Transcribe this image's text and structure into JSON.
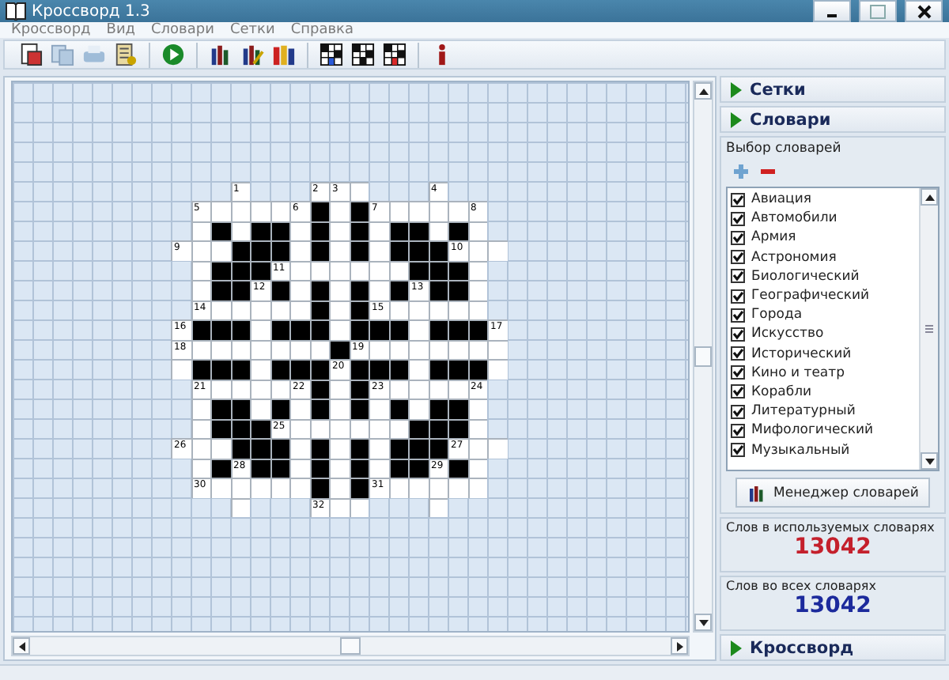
{
  "window": {
    "title": "Кроссворд 1.3"
  },
  "menu": [
    "Кроссворд",
    "Вид",
    "Словари",
    "Сетки",
    "Справка"
  ],
  "crossword": {
    "rows": [
      {
        "cells": [
          {
            "kind": "empty"
          },
          {
            "kind": "empty"
          },
          {
            "kind": "empty"
          },
          {
            "kind": "white",
            "number": "1"
          },
          {
            "kind": "empty"
          },
          {
            "kind": "empty"
          },
          {
            "kind": "empty"
          },
          {
            "kind": "white",
            "number": "2"
          },
          {
            "kind": "white",
            "number": "3"
          },
          {
            "kind": "white"
          },
          {
            "kind": "empty"
          },
          {
            "kind": "empty"
          },
          {
            "kind": "empty"
          },
          {
            "kind": "white",
            "number": "4"
          },
          {
            "kind": "empty"
          },
          {
            "kind": "empty"
          },
          {
            "kind": "empty"
          }
        ]
      },
      {
        "cells": [
          {
            "kind": "empty"
          },
          {
            "kind": "white",
            "number": "5"
          },
          {
            "kind": "white"
          },
          {
            "kind": "white"
          },
          {
            "kind": "white"
          },
          {
            "kind": "white"
          },
          {
            "kind": "white",
            "number": "6"
          },
          {
            "kind": "black"
          },
          {
            "kind": "white"
          },
          {
            "kind": "black"
          },
          {
            "kind": "white",
            "number": "7"
          },
          {
            "kind": "white"
          },
          {
            "kind": "white"
          },
          {
            "kind": "white"
          },
          {
            "kind": "white"
          },
          {
            "kind": "white",
            "number": "8"
          },
          {
            "kind": "empty"
          }
        ]
      },
      {
        "cells": [
          {
            "kind": "empty"
          },
          {
            "kind": "white"
          },
          {
            "kind": "black"
          },
          {
            "kind": "white"
          },
          {
            "kind": "black"
          },
          {
            "kind": "black"
          },
          {
            "kind": "white"
          },
          {
            "kind": "black"
          },
          {
            "kind": "white"
          },
          {
            "kind": "black"
          },
          {
            "kind": "white"
          },
          {
            "kind": "black"
          },
          {
            "kind": "black"
          },
          {
            "kind": "white"
          },
          {
            "kind": "black"
          },
          {
            "kind": "white"
          },
          {
            "kind": "empty"
          }
        ]
      },
      {
        "cells": [
          {
            "kind": "white",
            "number": "9"
          },
          {
            "kind": "white"
          },
          {
            "kind": "white"
          },
          {
            "kind": "black"
          },
          {
            "kind": "black"
          },
          {
            "kind": "black"
          },
          {
            "kind": "white"
          },
          {
            "kind": "black"
          },
          {
            "kind": "white"
          },
          {
            "kind": "black"
          },
          {
            "kind": "white"
          },
          {
            "kind": "black"
          },
          {
            "kind": "black"
          },
          {
            "kind": "black"
          },
          {
            "kind": "white",
            "number": "10"
          },
          {
            "kind": "white"
          },
          {
            "kind": "white"
          }
        ]
      },
      {
        "cells": [
          {
            "kind": "empty"
          },
          {
            "kind": "white"
          },
          {
            "kind": "black"
          },
          {
            "kind": "black"
          },
          {
            "kind": "black"
          },
          {
            "kind": "white",
            "number": "11"
          },
          {
            "kind": "white"
          },
          {
            "kind": "white"
          },
          {
            "kind": "white"
          },
          {
            "kind": "white"
          },
          {
            "kind": "white"
          },
          {
            "kind": "white"
          },
          {
            "kind": "black"
          },
          {
            "kind": "black"
          },
          {
            "kind": "black"
          },
          {
            "kind": "white"
          },
          {
            "kind": "empty"
          }
        ]
      },
      {
        "cells": [
          {
            "kind": "empty"
          },
          {
            "kind": "white"
          },
          {
            "kind": "black"
          },
          {
            "kind": "black"
          },
          {
            "kind": "white",
            "number": "12"
          },
          {
            "kind": "black"
          },
          {
            "kind": "white"
          },
          {
            "kind": "black"
          },
          {
            "kind": "white"
          },
          {
            "kind": "black"
          },
          {
            "kind": "white"
          },
          {
            "kind": "black"
          },
          {
            "kind": "white",
            "number": "13"
          },
          {
            "kind": "black"
          },
          {
            "kind": "black"
          },
          {
            "kind": "white"
          },
          {
            "kind": "empty"
          }
        ]
      },
      {
        "cells": [
          {
            "kind": "empty"
          },
          {
            "kind": "white",
            "number": "14"
          },
          {
            "kind": "white"
          },
          {
            "kind": "white"
          },
          {
            "kind": "white"
          },
          {
            "kind": "white"
          },
          {
            "kind": "white"
          },
          {
            "kind": "black"
          },
          {
            "kind": "white"
          },
          {
            "kind": "black"
          },
          {
            "kind": "white",
            "number": "15"
          },
          {
            "kind": "white"
          },
          {
            "kind": "white"
          },
          {
            "kind": "white"
          },
          {
            "kind": "white"
          },
          {
            "kind": "white"
          },
          {
            "kind": "empty"
          }
        ]
      },
      {
        "cells": [
          {
            "kind": "white",
            "number": "16"
          },
          {
            "kind": "black"
          },
          {
            "kind": "black"
          },
          {
            "kind": "black"
          },
          {
            "kind": "white"
          },
          {
            "kind": "black"
          },
          {
            "kind": "black"
          },
          {
            "kind": "black"
          },
          {
            "kind": "white"
          },
          {
            "kind": "black"
          },
          {
            "kind": "black"
          },
          {
            "kind": "black"
          },
          {
            "kind": "white"
          },
          {
            "kind": "black"
          },
          {
            "kind": "black"
          },
          {
            "kind": "black"
          },
          {
            "kind": "white",
            "number": "17"
          }
        ]
      },
      {
        "cells": [
          {
            "kind": "white",
            "number": "18"
          },
          {
            "kind": "white"
          },
          {
            "kind": "white"
          },
          {
            "kind": "white"
          },
          {
            "kind": "white"
          },
          {
            "kind": "white"
          },
          {
            "kind": "white"
          },
          {
            "kind": "white"
          },
          {
            "kind": "black"
          },
          {
            "kind": "white",
            "number": "19"
          },
          {
            "kind": "white"
          },
          {
            "kind": "white"
          },
          {
            "kind": "white"
          },
          {
            "kind": "white"
          },
          {
            "kind": "white"
          },
          {
            "kind": "white"
          },
          {
            "kind": "white"
          }
        ]
      },
      {
        "cells": [
          {
            "kind": "white"
          },
          {
            "kind": "black"
          },
          {
            "kind": "black"
          },
          {
            "kind": "black"
          },
          {
            "kind": "white"
          },
          {
            "kind": "black"
          },
          {
            "kind": "black"
          },
          {
            "kind": "black"
          },
          {
            "kind": "white",
            "number": "20"
          },
          {
            "kind": "black"
          },
          {
            "kind": "black"
          },
          {
            "kind": "black"
          },
          {
            "kind": "white"
          },
          {
            "kind": "black"
          },
          {
            "kind": "black"
          },
          {
            "kind": "black"
          },
          {
            "kind": "white"
          }
        ]
      },
      {
        "cells": [
          {
            "kind": "empty"
          },
          {
            "kind": "white",
            "number": "21"
          },
          {
            "kind": "white"
          },
          {
            "kind": "white"
          },
          {
            "kind": "white"
          },
          {
            "kind": "white"
          },
          {
            "kind": "white",
            "number": "22"
          },
          {
            "kind": "black"
          },
          {
            "kind": "white"
          },
          {
            "kind": "black"
          },
          {
            "kind": "white",
            "number": "23"
          },
          {
            "kind": "white"
          },
          {
            "kind": "white"
          },
          {
            "kind": "white"
          },
          {
            "kind": "white"
          },
          {
            "kind": "white",
            "number": "24"
          },
          {
            "kind": "empty"
          }
        ]
      },
      {
        "cells": [
          {
            "kind": "empty"
          },
          {
            "kind": "white"
          },
          {
            "kind": "black"
          },
          {
            "kind": "black"
          },
          {
            "kind": "white"
          },
          {
            "kind": "black"
          },
          {
            "kind": "white"
          },
          {
            "kind": "black"
          },
          {
            "kind": "white"
          },
          {
            "kind": "black"
          },
          {
            "kind": "white"
          },
          {
            "kind": "black"
          },
          {
            "kind": "white"
          },
          {
            "kind": "black"
          },
          {
            "kind": "black"
          },
          {
            "kind": "white"
          },
          {
            "kind": "empty"
          }
        ]
      },
      {
        "cells": [
          {
            "kind": "empty"
          },
          {
            "kind": "white"
          },
          {
            "kind": "black"
          },
          {
            "kind": "black"
          },
          {
            "kind": "black"
          },
          {
            "kind": "white",
            "number": "25"
          },
          {
            "kind": "white"
          },
          {
            "kind": "white"
          },
          {
            "kind": "white"
          },
          {
            "kind": "white"
          },
          {
            "kind": "white"
          },
          {
            "kind": "white"
          },
          {
            "kind": "black"
          },
          {
            "kind": "black"
          },
          {
            "kind": "black"
          },
          {
            "kind": "white"
          },
          {
            "kind": "empty"
          }
        ]
      },
      {
        "cells": [
          {
            "kind": "white",
            "number": "26"
          },
          {
            "kind": "white"
          },
          {
            "kind": "white"
          },
          {
            "kind": "black"
          },
          {
            "kind": "black"
          },
          {
            "kind": "black"
          },
          {
            "kind": "white"
          },
          {
            "kind": "black"
          },
          {
            "kind": "white"
          },
          {
            "kind": "black"
          },
          {
            "kind": "white"
          },
          {
            "kind": "black"
          },
          {
            "kind": "black"
          },
          {
            "kind": "black"
          },
          {
            "kind": "white",
            "number": "27"
          },
          {
            "kind": "white"
          },
          {
            "kind": "white"
          }
        ]
      },
      {
        "cells": [
          {
            "kind": "empty"
          },
          {
            "kind": "white"
          },
          {
            "kind": "black"
          },
          {
            "kind": "white",
            "number": "28"
          },
          {
            "kind": "black"
          },
          {
            "kind": "black"
          },
          {
            "kind": "white"
          },
          {
            "kind": "black"
          },
          {
            "kind": "white"
          },
          {
            "kind": "black"
          },
          {
            "kind": "white"
          },
          {
            "kind": "black"
          },
          {
            "kind": "black"
          },
          {
            "kind": "white",
            "number": "29"
          },
          {
            "kind": "black"
          },
          {
            "kind": "white"
          },
          {
            "kind": "empty"
          }
        ]
      },
      {
        "cells": [
          {
            "kind": "empty"
          },
          {
            "kind": "white",
            "number": "30"
          },
          {
            "kind": "white"
          },
          {
            "kind": "white"
          },
          {
            "kind": "white"
          },
          {
            "kind": "white"
          },
          {
            "kind": "white"
          },
          {
            "kind": "black"
          },
          {
            "kind": "white"
          },
          {
            "kind": "black"
          },
          {
            "kind": "white",
            "number": "31"
          },
          {
            "kind": "white"
          },
          {
            "kind": "white"
          },
          {
            "kind": "white"
          },
          {
            "kind": "white"
          },
          {
            "kind": "white"
          },
          {
            "kind": "empty"
          }
        ]
      },
      {
        "cells": [
          {
            "kind": "empty"
          },
          {
            "kind": "empty"
          },
          {
            "kind": "empty"
          },
          {
            "kind": "white"
          },
          {
            "kind": "empty"
          },
          {
            "kind": "empty"
          },
          {
            "kind": "empty"
          },
          {
            "kind": "white",
            "number": "32"
          },
          {
            "kind": "white"
          },
          {
            "kind": "white"
          },
          {
            "kind": "empty"
          },
          {
            "kind": "empty"
          },
          {
            "kind": "empty"
          },
          {
            "kind": "white"
          },
          {
            "kind": "empty"
          },
          {
            "kind": "empty"
          },
          {
            "kind": "empty"
          }
        ]
      }
    ]
  },
  "panel": {
    "grids_header": "Сетки",
    "dictionaries_header": "Словари",
    "legend": "Выбор словарей",
    "items": [
      {
        "label": "Авиация",
        "checked": true
      },
      {
        "label": "Автомобили",
        "checked": true
      },
      {
        "label": "Армия",
        "checked": true
      },
      {
        "label": "Астрономия",
        "checked": true
      },
      {
        "label": "Биологический",
        "checked": true
      },
      {
        "label": "Географический",
        "checked": true
      },
      {
        "label": "Города",
        "checked": true
      },
      {
        "label": "Искусство",
        "checked": true
      },
      {
        "label": "Исторический",
        "checked": true
      },
      {
        "label": "Кино и театр",
        "checked": true
      },
      {
        "label": "Корабли",
        "checked": true
      },
      {
        "label": "Литературный",
        "checked": true
      },
      {
        "label": "Мифологический",
        "checked": true
      },
      {
        "label": "Музыкальный",
        "checked": true
      }
    ],
    "manager_button": "Менеджер словарей",
    "stats": [
      {
        "label": "Слов в используемых словарях",
        "value": "13042",
        "color": "#c4202c"
      },
      {
        "label": "Слов во всех словарях",
        "value": "13042",
        "color": "#1c2a9c"
      }
    ],
    "crossword_header": "Кроссворд"
  }
}
